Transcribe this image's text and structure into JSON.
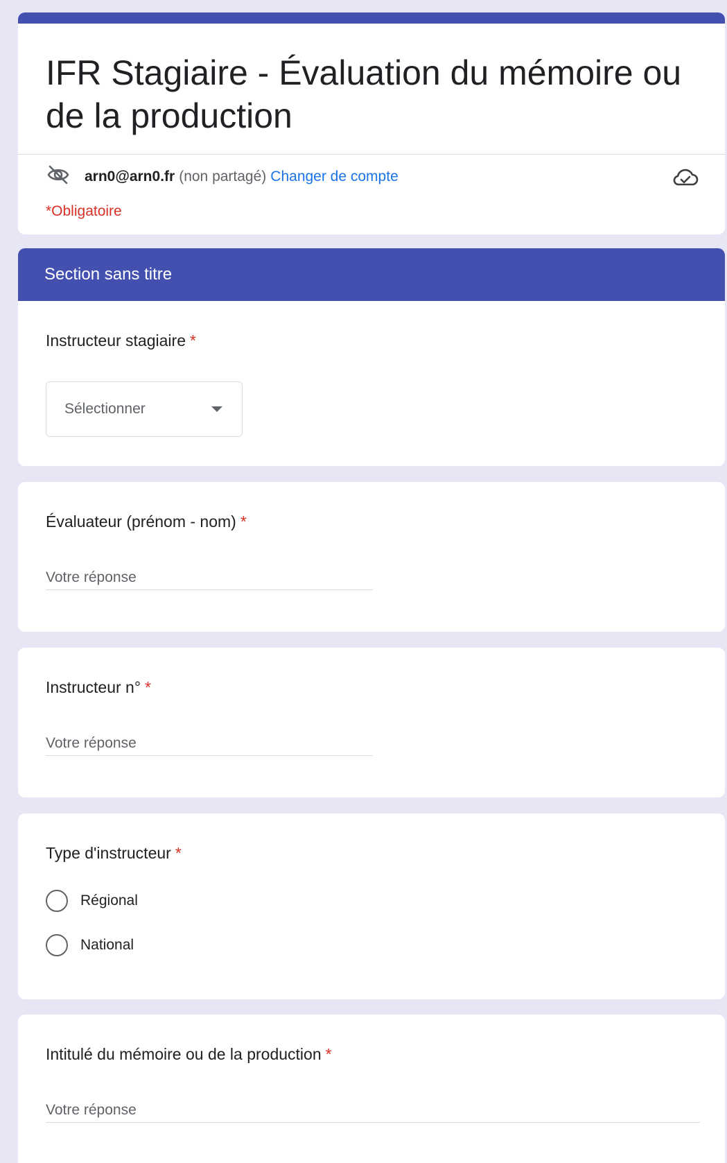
{
  "header": {
    "title": "IFR Stagiaire - Évaluation du mémoire ou de la production",
    "account_email": "arn0@arn0.fr",
    "account_share_status": "(non partagé)",
    "switch_account_label": "Changer de compte",
    "required_note": "*Obligatoire",
    "icons": [
      "eye-off-icon",
      "cloud-check-icon"
    ]
  },
  "section": {
    "title": "Section sans titre"
  },
  "questions": [
    {
      "label": "Instructeur stagiaire",
      "required_mark": "*",
      "type": "select",
      "selected": "Sélectionner"
    },
    {
      "label": "Évaluateur (prénom - nom)",
      "required_mark": "*",
      "type": "text",
      "placeholder": "Votre réponse"
    },
    {
      "label": "Instructeur n°",
      "required_mark": "*",
      "type": "text",
      "placeholder": "Votre réponse"
    },
    {
      "label": "Type d'instructeur",
      "required_mark": "*",
      "type": "radio",
      "options": [
        "Régional",
        "National"
      ]
    },
    {
      "label": "Intitulé du mémoire ou de la production",
      "required_mark": "*",
      "type": "text",
      "placeholder": "Votre réponse"
    }
  ],
  "colors": {
    "accent": "#4350af",
    "background": "#e6e6f4",
    "required": "#d93025",
    "link": "#1a73e8"
  }
}
